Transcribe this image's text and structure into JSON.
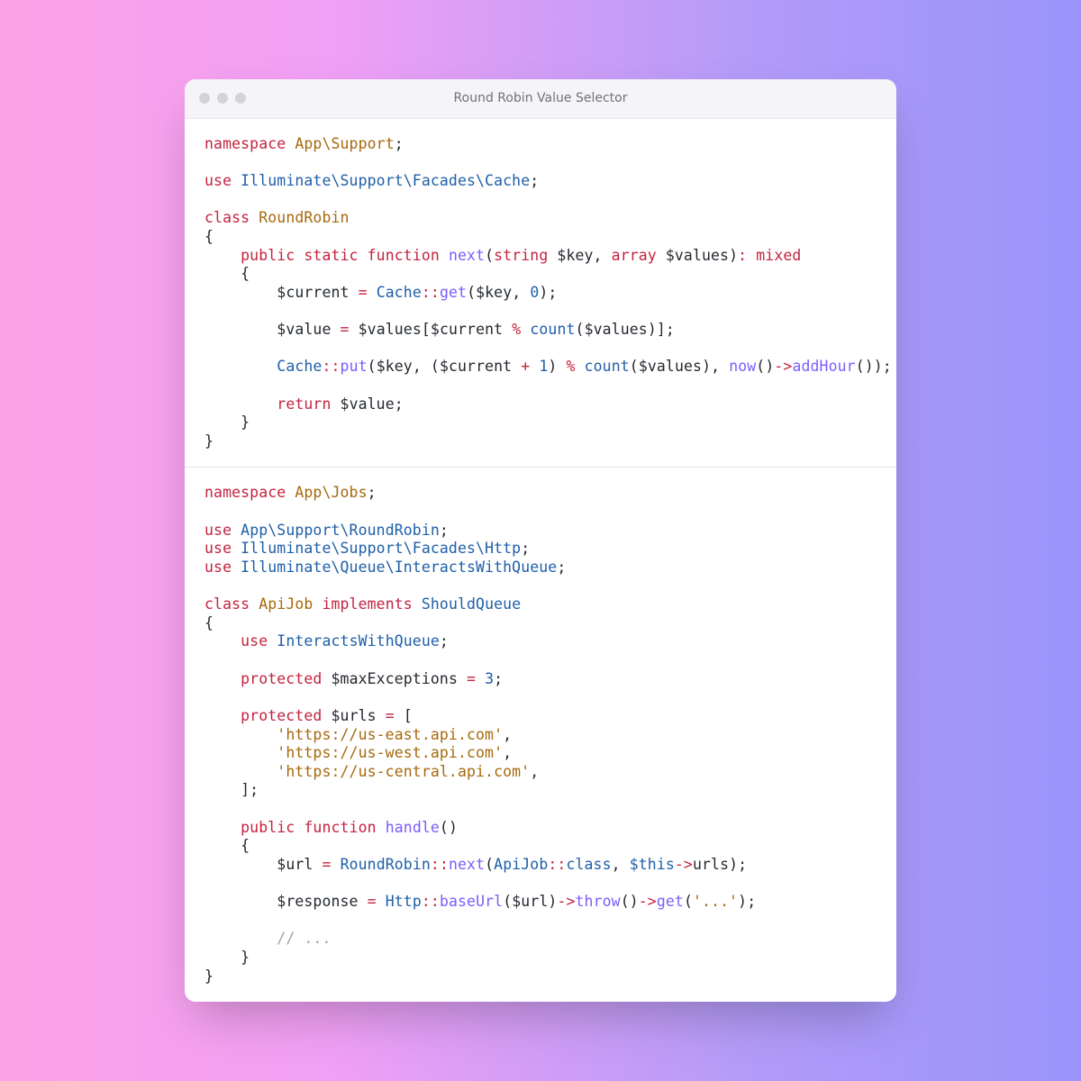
{
  "window": {
    "title": "Round Robin Value Selector"
  },
  "block1": {
    "namespace_kw": "namespace",
    "namespace_val": "App\\Support",
    "use_kw": "use",
    "use1": "Illuminate\\Support\\Facades\\Cache",
    "class_kw": "class",
    "class_name": "RoundRobin",
    "public_kw": "public",
    "static_kw": "static",
    "function_kw": "function",
    "fn_name": "next",
    "t_string": "string",
    "p_key": "$key",
    "t_array": "array",
    "p_values": "$values",
    "ret_mixed": "mixed",
    "v_current": "$current",
    "cache": "Cache",
    "m_get": "get",
    "zero": "0",
    "v_value": "$value",
    "count": "count",
    "m_put": "put",
    "one": "1",
    "now": "now",
    "addHour": "addHour",
    "return_kw": "return"
  },
  "block2": {
    "namespace_kw": "namespace",
    "namespace_val": "App\\Jobs",
    "use_kw": "use",
    "use1": "App\\Support\\RoundRobin",
    "use2": "Illuminate\\Support\\Facades\\Http",
    "use3": "Illuminate\\Queue\\InteractsWithQueue",
    "class_kw": "class",
    "class_name": "ApiJob",
    "implements_kw": "implements",
    "should_queue": "ShouldQueue",
    "use_trait_kw": "use",
    "trait": "InteractsWithQueue",
    "protected_kw": "protected",
    "maxExceptions": "$maxExceptions",
    "three": "3",
    "urls_var": "$urls",
    "url1": "'https://us-east.api.com'",
    "url2": "'https://us-west.api.com'",
    "url3": "'https://us-central.api.com'",
    "public_kw": "public",
    "function_kw": "function",
    "handle": "handle",
    "v_url": "$url",
    "rr": "RoundRobin",
    "m_next": "next",
    "apijob": "ApiJob",
    "class_const": "class",
    "this": "$this",
    "urls_prop": "urls",
    "v_response": "$response",
    "http": "Http",
    "baseUrl": "baseUrl",
    "throw": "throw",
    "get": "get",
    "dots_str": "'...'",
    "comment": "// ..."
  }
}
